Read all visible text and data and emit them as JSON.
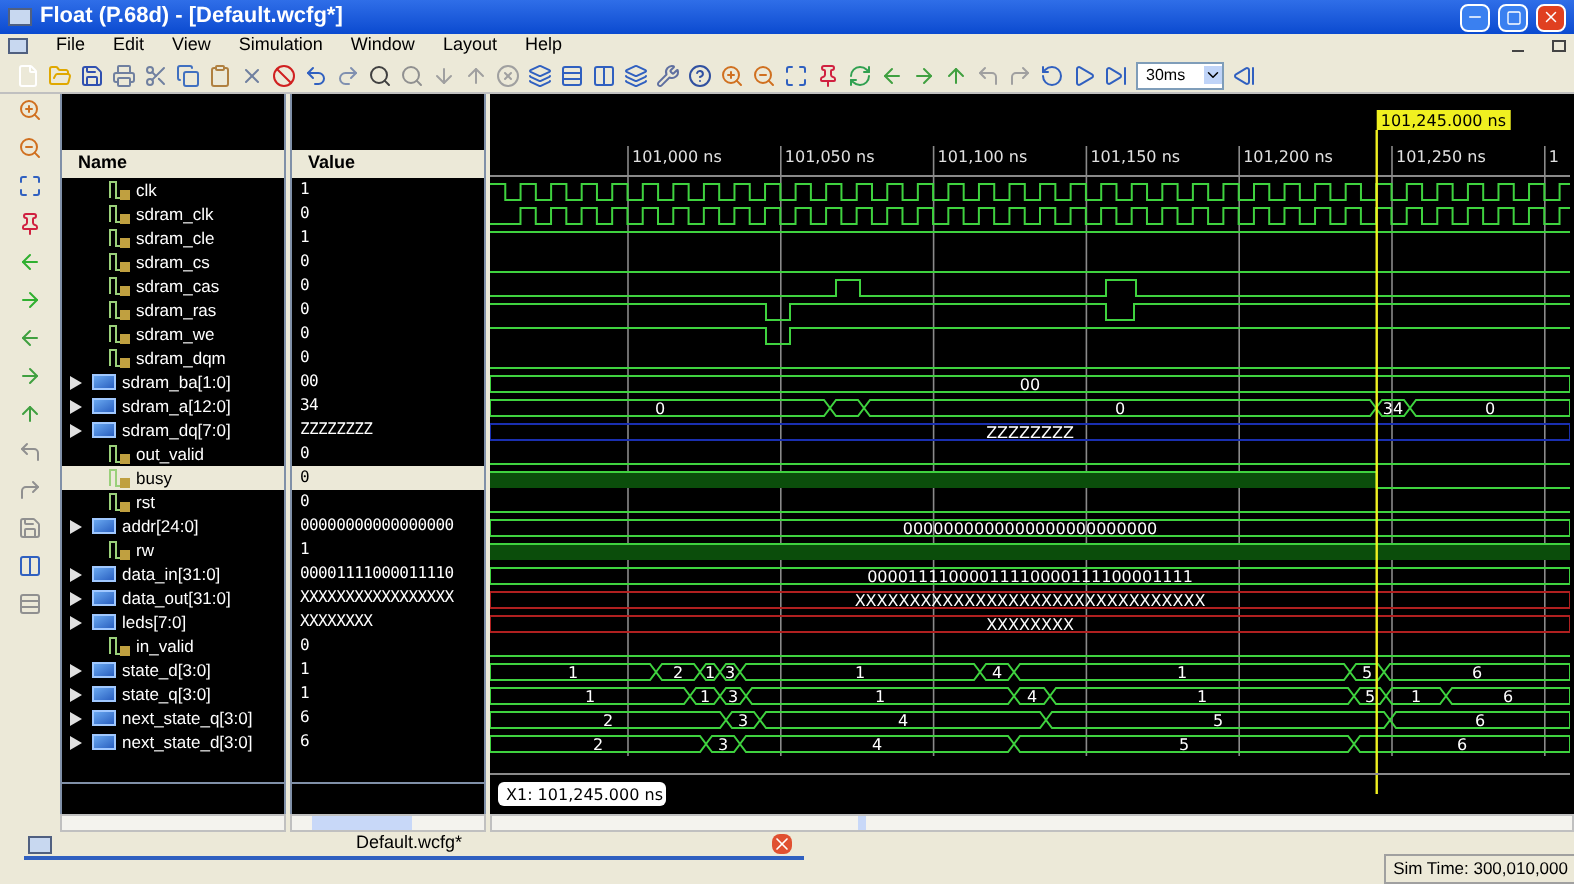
{
  "window": {
    "title": "Float (P.68d) - [Default.wcfg*]"
  },
  "menu": [
    "File",
    "Edit",
    "View",
    "Simulation",
    "Window",
    "Layout",
    "Help"
  ],
  "toolbar": {
    "run_time": "30ms"
  },
  "columns": [
    "Name",
    "Value"
  ],
  "timeline": {
    "ticks": [
      "101,000 ns",
      "101,050 ns",
      "101,100 ns",
      "101,150 ns",
      "101,200 ns",
      "101,250 ns",
      "1"
    ],
    "cursor": "101,245.000 ns",
    "cursor_readout": "X1: 101,245.000 ns"
  },
  "signals": [
    {
      "name": "clk",
      "value": "1",
      "kind": "bit",
      "selected": false
    },
    {
      "name": "sdram_clk",
      "value": "0",
      "kind": "bit",
      "selected": false
    },
    {
      "name": "sdram_cle",
      "value": "1",
      "kind": "bit",
      "selected": false
    },
    {
      "name": "sdram_cs",
      "value": "0",
      "kind": "bit",
      "selected": false
    },
    {
      "name": "sdram_cas",
      "value": "0",
      "kind": "bit",
      "selected": false
    },
    {
      "name": "sdram_ras",
      "value": "0",
      "kind": "bit",
      "selected": false
    },
    {
      "name": "sdram_we",
      "value": "0",
      "kind": "bit",
      "selected": false
    },
    {
      "name": "sdram_dqm",
      "value": "0",
      "kind": "bit",
      "selected": false
    },
    {
      "name": "sdram_ba[1:0]",
      "value": "00",
      "kind": "bus",
      "selected": false,
      "wave_labels": [
        "00"
      ]
    },
    {
      "name": "sdram_a[12:0]",
      "value": "34",
      "kind": "bus",
      "selected": false,
      "wave_labels": [
        "0",
        "0",
        "34",
        "0"
      ]
    },
    {
      "name": "sdram_dq[7:0]",
      "value": "ZZZZZZZZ",
      "kind": "bus",
      "selected": false,
      "wave_labels": [
        "ZZZZZZZZ"
      ]
    },
    {
      "name": "out_valid",
      "value": "0",
      "kind": "bit",
      "selected": false
    },
    {
      "name": "busy",
      "value": "0",
      "kind": "bit",
      "selected": true
    },
    {
      "name": "rst",
      "value": "0",
      "kind": "bit",
      "selected": false
    },
    {
      "name": "addr[24:0]",
      "value": "00000000000000000",
      "kind": "bus",
      "selected": false,
      "wave_labels": [
        "0000000000000000000000000"
      ]
    },
    {
      "name": "rw",
      "value": "1",
      "kind": "bit",
      "selected": false
    },
    {
      "name": "data_in[31:0]",
      "value": "00001111000011110",
      "kind": "bus",
      "selected": false,
      "wave_labels": [
        "00001111000011110000111100001111"
      ]
    },
    {
      "name": "data_out[31:0]",
      "value": "XXXXXXXXXXXXXXXXX",
      "kind": "bus",
      "selected": false,
      "wave_labels": [
        "XXXXXXXXXXXXXXXXXXXXXXXXXXXXXXXX"
      ]
    },
    {
      "name": "leds[7:0]",
      "value": "XXXXXXXX",
      "kind": "bus",
      "selected": false,
      "wave_labels": [
        "XXXXXXXX"
      ]
    },
    {
      "name": "in_valid",
      "value": "0",
      "kind": "bit",
      "selected": false
    },
    {
      "name": "state_d[3:0]",
      "value": "1",
      "kind": "bus",
      "selected": false,
      "wave_labels": [
        "1",
        "2",
        "1",
        "3",
        "1",
        "4",
        "1",
        "5",
        "6"
      ]
    },
    {
      "name": "state_q[3:0]",
      "value": "1",
      "kind": "bus",
      "selected": false,
      "wave_labels": [
        "1",
        "1",
        "3",
        "1",
        "4",
        "1",
        "5",
        "1",
        "6"
      ]
    },
    {
      "name": "next_state_q[3:0]",
      "value": "6",
      "kind": "bus",
      "selected": false,
      "wave_labels": [
        "2",
        "3",
        "4",
        "5",
        "6"
      ]
    },
    {
      "name": "next_state_d[3:0]",
      "value": "6",
      "kind": "bus",
      "selected": false,
      "wave_labels": [
        "2",
        "3",
        "4",
        "5",
        "6"
      ]
    }
  ],
  "document_tab": {
    "label": "Default.wcfg*"
  },
  "status_bar": {
    "sim_time": "Sim Time: 300,010,000"
  }
}
